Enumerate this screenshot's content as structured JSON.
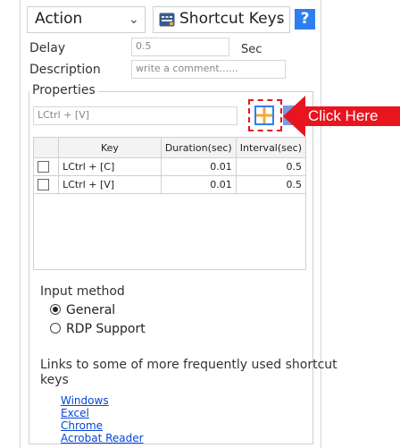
{
  "header": {
    "type_select": "Action",
    "action_select": "Shortcut Keys",
    "help_label": "?"
  },
  "fields": {
    "delay_label": "Delay",
    "delay_value": "0.5",
    "delay_unit": "Sec",
    "description_label": "Description",
    "description_placeholder": "write a comment......"
  },
  "properties": {
    "title": "Properties",
    "shortcut_value": "LCtrl + [V]",
    "columns": [
      "Key",
      "Duration(sec)",
      "Interval(sec)"
    ],
    "rows": [
      {
        "key": "LCtrl + [C]",
        "duration": "0.01",
        "interval": "0.5"
      },
      {
        "key": "LCtrl + [V]",
        "duration": "0.01",
        "interval": "0.5"
      }
    ],
    "callout_label": "Click Here"
  },
  "input_method": {
    "label": "Input method",
    "options": [
      {
        "label": "General",
        "selected": true
      },
      {
        "label": "RDP Support",
        "selected": false
      }
    ]
  },
  "links": {
    "intro_line1": "Links to some of more frequently used shortcut",
    "intro_line2": "keys",
    "items": [
      "Windows",
      "Excel",
      "Chrome",
      "Acrobat Reader"
    ]
  },
  "colors": {
    "accent": "#2d7ff0",
    "callout": "#e8141e",
    "link": "#0645d8"
  },
  "icons": [
    "keyboard-icon",
    "help-icon",
    "add-grid-icon",
    "arrow-callout-icon"
  ]
}
